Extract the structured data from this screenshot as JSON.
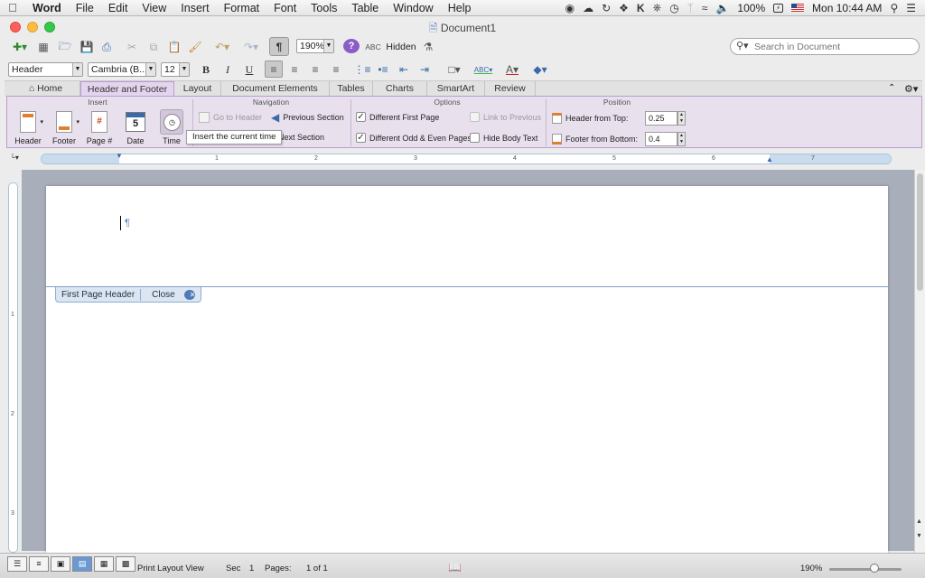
{
  "menubar": {
    "app": "Word",
    "items": [
      "File",
      "Edit",
      "View",
      "Insert",
      "Format",
      "Font",
      "Tools",
      "Table",
      "Window",
      "Help"
    ],
    "battery": "100%",
    "clock": "Mon 10:44 AM"
  },
  "window": {
    "title": "Document1"
  },
  "toolbar": {
    "zoom": "190%",
    "hidden_label": "Hidden",
    "spell_label": "ABC",
    "search_placeholder": "Search in Document"
  },
  "format_bar": {
    "style": "Header",
    "font": "Cambria (B...",
    "size": "12",
    "bold": "B",
    "italic": "I",
    "underline": "U"
  },
  "ribbon_tabs": [
    "Home",
    "Header and Footer",
    "Layout",
    "Document Elements",
    "Tables",
    "Charts",
    "SmartArt",
    "Review"
  ],
  "ribbon": {
    "groups": {
      "insert": "Insert",
      "navigation": "Navigation",
      "options": "Options",
      "position": "Position"
    },
    "insert": {
      "header": "Header",
      "footer": "Footer",
      "page_num": "Page #",
      "date": "Date",
      "date_icon": "5",
      "time": "Time"
    },
    "navigation": {
      "go_to_header": "Go to Header",
      "previous_section": "Previous Section",
      "next_section": "Next Section"
    },
    "options": {
      "different_first_page": "Different First Page",
      "different_odd_even": "Different Odd & Even Pages",
      "link_to_previous": "Link to Previous",
      "hide_body_text": "Hide Body Text"
    },
    "position": {
      "header_from_top_label": "Header from Top:",
      "header_from_top_value": "0.25",
      "footer_from_bottom_label": "Footer from Bottom:",
      "footer_from_bottom_value": "0.4"
    },
    "tooltip": "Insert the current time"
  },
  "ruler": {
    "h_numbers": [
      "1",
      "2",
      "3",
      "4",
      "5",
      "6",
      "7"
    ],
    "v_numbers": [
      "1",
      "2",
      "3"
    ]
  },
  "document": {
    "header_tab": "First Page Header",
    "close_label": "Close",
    "pilcrow": "¶"
  },
  "statusbar": {
    "view": "Print Layout View",
    "sec_label": "Sec",
    "sec_value": "1",
    "pages_label": "Pages:",
    "pages_value": "1 of 1",
    "zoom": "190%"
  }
}
